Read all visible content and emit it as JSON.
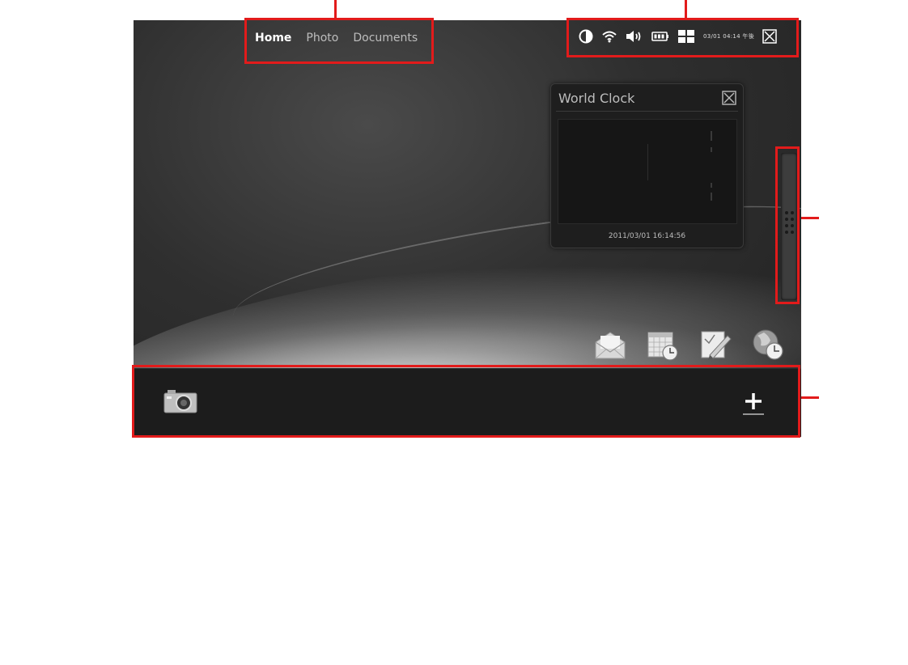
{
  "tabs": [
    {
      "label": "Home",
      "active": true
    },
    {
      "label": "Photo",
      "active": false
    },
    {
      "label": "Documents",
      "active": false
    }
  ],
  "status_bar": {
    "icons": [
      "brightness-icon",
      "wifi-icon",
      "volume-icon",
      "battery-icon",
      "grid-icon",
      "close-icon"
    ],
    "datetime": "03/01 04:14 午後"
  },
  "world_clock": {
    "title": "World Clock",
    "timestamp": "2011/03/01 16:14:56"
  },
  "desktop_icons": [
    "mail-icon",
    "calendar-clock-icon",
    "notepad-icon",
    "world-clock-icon"
  ],
  "dock": {
    "left_icon": "camera-icon",
    "right_icon": "plus-icon"
  },
  "colors": {
    "callout": "#e21b1b",
    "dock": "#1c1c1c",
    "widget": "#1e1e1e"
  }
}
